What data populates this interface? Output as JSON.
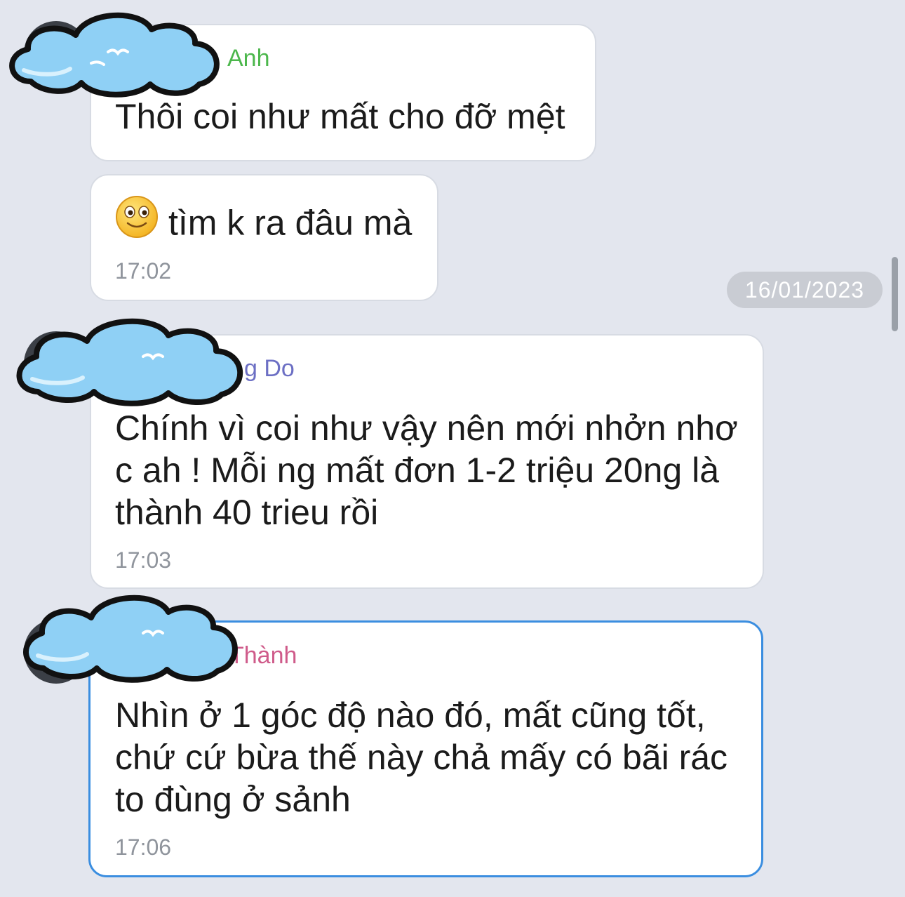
{
  "date_separator": "16/01/2023",
  "messages": [
    {
      "sender_fragment": "Anh",
      "sender_color": "#4cb74c",
      "lines": [
        "Thôi coi như mất cho đỡ mệt"
      ]
    },
    {
      "emoji": "slightly-smiling-face-icon",
      "lines": [
        "tìm k ra đâu mà"
      ],
      "time": "17:02"
    },
    {
      "sender_fragment": "g Do",
      "sender_color": "#6c6fc4",
      "lines": [
        "Chính vì coi như vậy nên mới nhởn nhơ",
        "c ah ! Mỗi ng mất đơn 1-2 triệu 20ng là",
        "thành 40 trieu rồi"
      ],
      "time": "17:03"
    },
    {
      "sender_fragment": "Thành",
      "sender_color": "#cf5b8a",
      "lines": [
        "Nhìn ở 1 góc độ nào đó, mất cũng tốt,",
        "chứ cứ bừa thế này chả mấy có bãi rác",
        "to đùng ở sảnh"
      ],
      "time": "17:06"
    }
  ],
  "colors": {
    "background": "#e3e6ee",
    "bubble": "#ffffff",
    "selected_border": "#3b8ee0",
    "cloud_fill": "#8fd0f5"
  }
}
